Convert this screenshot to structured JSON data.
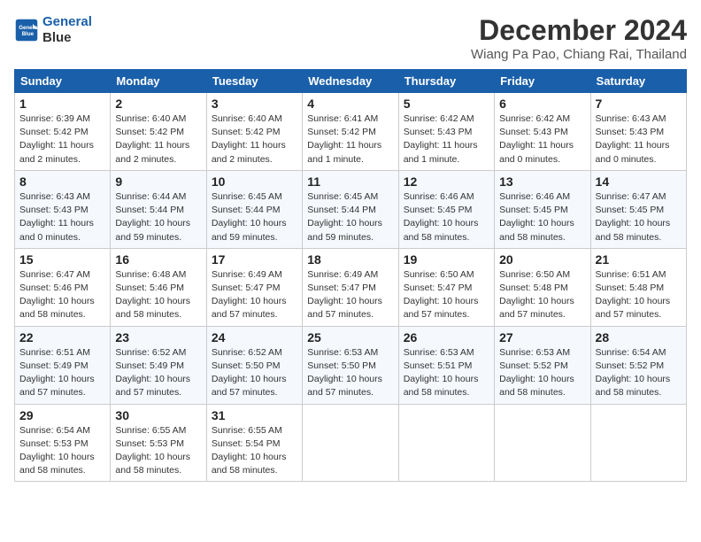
{
  "logo": {
    "line1": "General",
    "line2": "Blue"
  },
  "title": "December 2024",
  "location": "Wiang Pa Pao, Chiang Rai, Thailand",
  "weekdays": [
    "Sunday",
    "Monday",
    "Tuesday",
    "Wednesday",
    "Thursday",
    "Friday",
    "Saturday"
  ],
  "weeks": [
    [
      {
        "day": 1,
        "sunrise": "6:39 AM",
        "sunset": "5:42 PM",
        "daylight": "11 hours and 2 minutes."
      },
      {
        "day": 2,
        "sunrise": "6:40 AM",
        "sunset": "5:42 PM",
        "daylight": "11 hours and 2 minutes."
      },
      {
        "day": 3,
        "sunrise": "6:40 AM",
        "sunset": "5:42 PM",
        "daylight": "11 hours and 2 minutes."
      },
      {
        "day": 4,
        "sunrise": "6:41 AM",
        "sunset": "5:42 PM",
        "daylight": "11 hours and 1 minute."
      },
      {
        "day": 5,
        "sunrise": "6:42 AM",
        "sunset": "5:43 PM",
        "daylight": "11 hours and 1 minute."
      },
      {
        "day": 6,
        "sunrise": "6:42 AM",
        "sunset": "5:43 PM",
        "daylight": "11 hours and 0 minutes."
      },
      {
        "day": 7,
        "sunrise": "6:43 AM",
        "sunset": "5:43 PM",
        "daylight": "11 hours and 0 minutes."
      }
    ],
    [
      {
        "day": 8,
        "sunrise": "6:43 AM",
        "sunset": "5:43 PM",
        "daylight": "11 hours and 0 minutes."
      },
      {
        "day": 9,
        "sunrise": "6:44 AM",
        "sunset": "5:44 PM",
        "daylight": "10 hours and 59 minutes."
      },
      {
        "day": 10,
        "sunrise": "6:45 AM",
        "sunset": "5:44 PM",
        "daylight": "10 hours and 59 minutes."
      },
      {
        "day": 11,
        "sunrise": "6:45 AM",
        "sunset": "5:44 PM",
        "daylight": "10 hours and 59 minutes."
      },
      {
        "day": 12,
        "sunrise": "6:46 AM",
        "sunset": "5:45 PM",
        "daylight": "10 hours and 58 minutes."
      },
      {
        "day": 13,
        "sunrise": "6:46 AM",
        "sunset": "5:45 PM",
        "daylight": "10 hours and 58 minutes."
      },
      {
        "day": 14,
        "sunrise": "6:47 AM",
        "sunset": "5:45 PM",
        "daylight": "10 hours and 58 minutes."
      }
    ],
    [
      {
        "day": 15,
        "sunrise": "6:47 AM",
        "sunset": "5:46 PM",
        "daylight": "10 hours and 58 minutes."
      },
      {
        "day": 16,
        "sunrise": "6:48 AM",
        "sunset": "5:46 PM",
        "daylight": "10 hours and 58 minutes."
      },
      {
        "day": 17,
        "sunrise": "6:49 AM",
        "sunset": "5:47 PM",
        "daylight": "10 hours and 57 minutes."
      },
      {
        "day": 18,
        "sunrise": "6:49 AM",
        "sunset": "5:47 PM",
        "daylight": "10 hours and 57 minutes."
      },
      {
        "day": 19,
        "sunrise": "6:50 AM",
        "sunset": "5:47 PM",
        "daylight": "10 hours and 57 minutes."
      },
      {
        "day": 20,
        "sunrise": "6:50 AM",
        "sunset": "5:48 PM",
        "daylight": "10 hours and 57 minutes."
      },
      {
        "day": 21,
        "sunrise": "6:51 AM",
        "sunset": "5:48 PM",
        "daylight": "10 hours and 57 minutes."
      }
    ],
    [
      {
        "day": 22,
        "sunrise": "6:51 AM",
        "sunset": "5:49 PM",
        "daylight": "10 hours and 57 minutes."
      },
      {
        "day": 23,
        "sunrise": "6:52 AM",
        "sunset": "5:49 PM",
        "daylight": "10 hours and 57 minutes."
      },
      {
        "day": 24,
        "sunrise": "6:52 AM",
        "sunset": "5:50 PM",
        "daylight": "10 hours and 57 minutes."
      },
      {
        "day": 25,
        "sunrise": "6:53 AM",
        "sunset": "5:50 PM",
        "daylight": "10 hours and 57 minutes."
      },
      {
        "day": 26,
        "sunrise": "6:53 AM",
        "sunset": "5:51 PM",
        "daylight": "10 hours and 58 minutes."
      },
      {
        "day": 27,
        "sunrise": "6:53 AM",
        "sunset": "5:52 PM",
        "daylight": "10 hours and 58 minutes."
      },
      {
        "day": 28,
        "sunrise": "6:54 AM",
        "sunset": "5:52 PM",
        "daylight": "10 hours and 58 minutes."
      }
    ],
    [
      {
        "day": 29,
        "sunrise": "6:54 AM",
        "sunset": "5:53 PM",
        "daylight": "10 hours and 58 minutes."
      },
      {
        "day": 30,
        "sunrise": "6:55 AM",
        "sunset": "5:53 PM",
        "daylight": "10 hours and 58 minutes."
      },
      {
        "day": 31,
        "sunrise": "6:55 AM",
        "sunset": "5:54 PM",
        "daylight": "10 hours and 58 minutes."
      },
      null,
      null,
      null,
      null
    ]
  ],
  "labels": {
    "sunrise": "Sunrise:",
    "sunset": "Sunset:",
    "daylight": "Daylight:"
  }
}
